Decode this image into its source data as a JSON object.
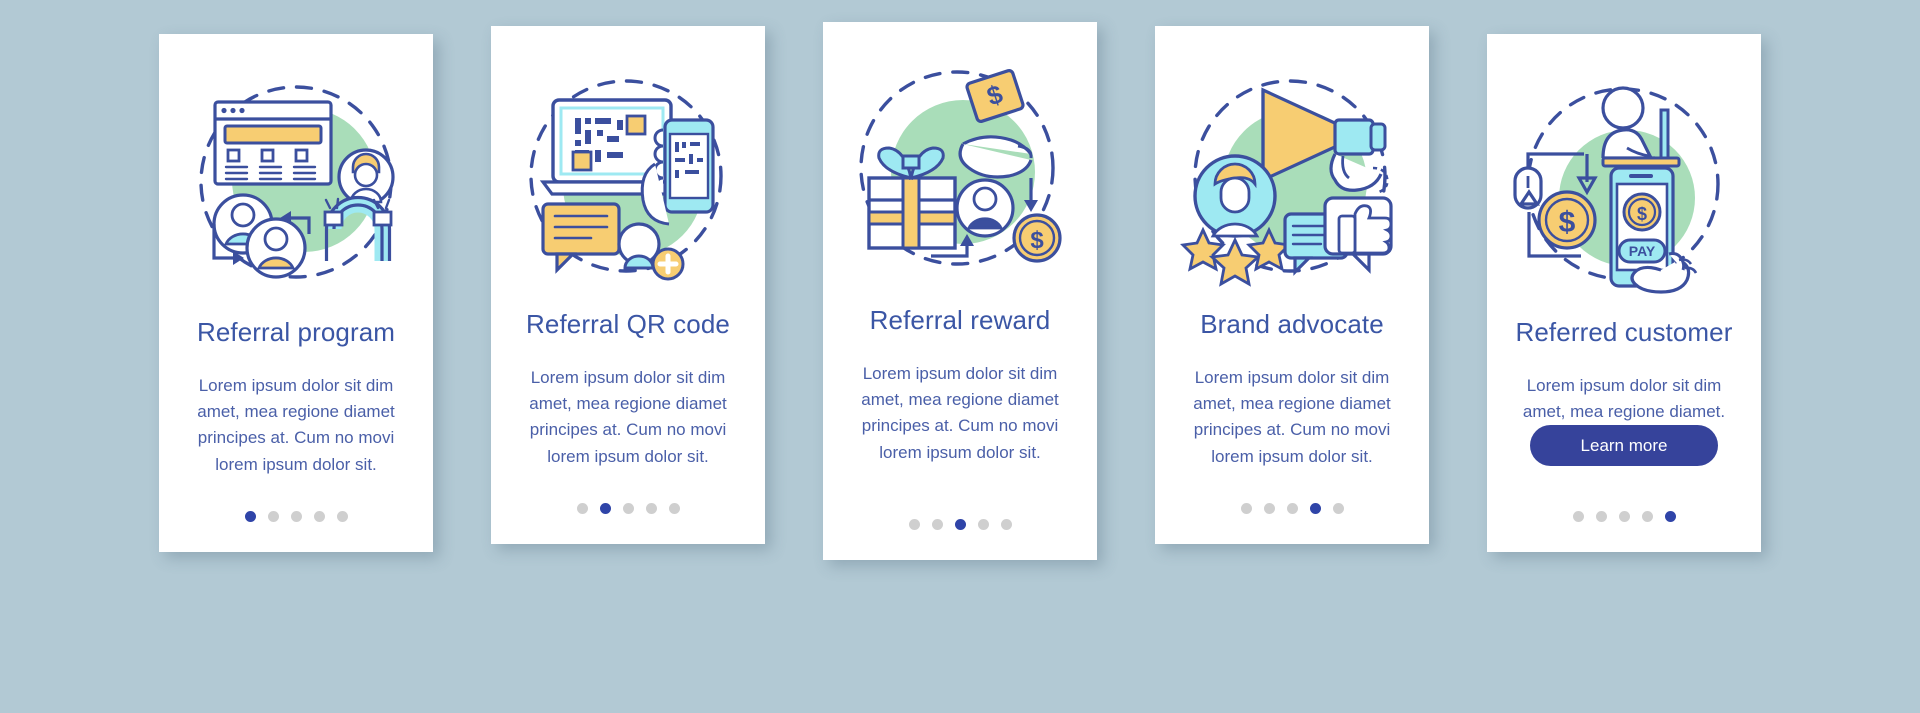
{
  "page": {
    "background_color": "#b2c9d4",
    "card_background": "#ffffff",
    "title_color": "#3b56a5",
    "body_color": "#4a5fa8",
    "dot_active_color": "#2f44a8",
    "dot_inactive_color": "#cfcfcf",
    "accent_yellow": "#f7cd72",
    "accent_cyan": "#9ee9f2",
    "accent_green": "#a9ddb9",
    "outline_blue": "#3b4f9e"
  },
  "cards": [
    {
      "id": "referral-program",
      "illustration": "referral-program-icon",
      "title": "Referral program",
      "body": "Lorem ipsum dolor sit dim amet, mea regione diamet principes at. Cum no movi lorem ipsum dolor sit.",
      "has_button": false,
      "button_label": "",
      "dots": {
        "count": 5,
        "active": 1
      }
    },
    {
      "id": "referral-qr-code",
      "illustration": "referral-qr-code-icon",
      "title": "Referral QR code",
      "body": "Lorem ipsum dolor sit dim amet, mea regione diamet principes at. Cum no movi lorem ipsum dolor sit.",
      "has_button": false,
      "button_label": "",
      "dots": {
        "count": 5,
        "active": 2
      }
    },
    {
      "id": "referral-reward",
      "illustration": "referral-reward-icon",
      "title": "Referral reward",
      "body": "Lorem ipsum dolor sit dim amet, mea regione diamet principes at. Cum no movi lorem ipsum dolor sit.",
      "has_button": false,
      "button_label": "",
      "dots": {
        "count": 5,
        "active": 3
      }
    },
    {
      "id": "brand-advocate",
      "illustration": "brand-advocate-icon",
      "title": "Brand advocate",
      "body": "Lorem ipsum dolor sit dim amet, mea regione diamet principes at. Cum no movi lorem ipsum dolor sit.",
      "has_button": false,
      "button_label": "",
      "dots": {
        "count": 5,
        "active": 4
      }
    },
    {
      "id": "referred-customer",
      "illustration": "referred-customer-icon",
      "title": "Referred customer",
      "body": "Lorem ipsum dolor sit dim amet, mea regione diamet.",
      "has_button": true,
      "button_label": "Learn more",
      "dots": {
        "count": 5,
        "active": 5
      }
    }
  ],
  "illustration_labels": {
    "referral_reward_badge": "$",
    "referred_customer_pay": "PAY",
    "referred_customer_coin": "$",
    "referral_reward_coin": "$"
  }
}
